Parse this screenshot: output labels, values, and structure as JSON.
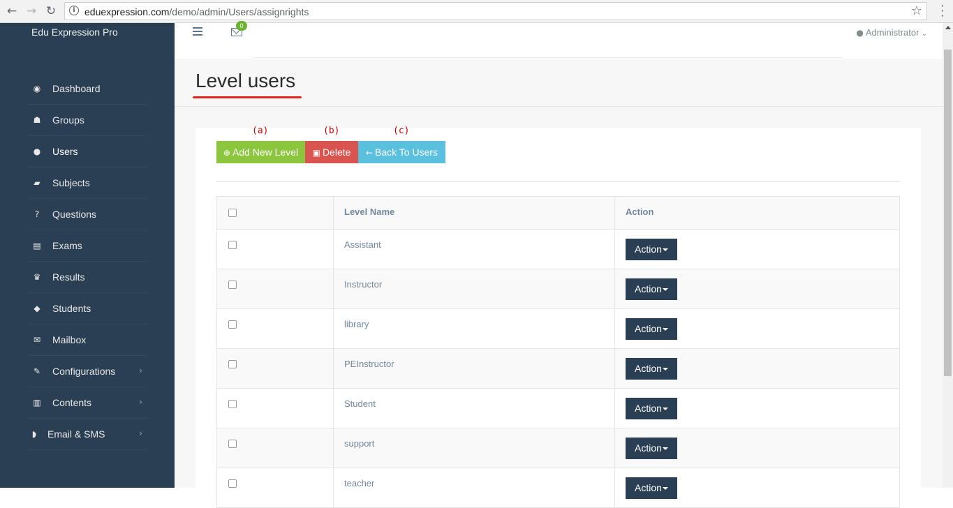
{
  "browser": {
    "back": "←",
    "forward": "→",
    "reload": "↻",
    "url_host": "eduexpression.com",
    "url_path": "/demo/admin/Users/assignrights"
  },
  "brand": "Edu Expression Pro",
  "sidebar": {
    "items": [
      {
        "label": "Dashboard",
        "icon": "dashboard-icon",
        "glyph": "◉"
      },
      {
        "label": "Groups",
        "icon": "users-group-icon",
        "glyph": "☗"
      },
      {
        "label": "Users",
        "icon": "user-icon",
        "glyph": "●"
      },
      {
        "label": "Subjects",
        "icon": "book-icon",
        "glyph": "▰"
      },
      {
        "label": "Questions",
        "icon": "question-icon",
        "glyph": "?"
      },
      {
        "label": "Exams",
        "icon": "list-icon",
        "glyph": "▤"
      },
      {
        "label": "Results",
        "icon": "trophy-icon",
        "glyph": "♛"
      },
      {
        "label": "Students",
        "icon": "graduation-cap-icon",
        "glyph": "◆"
      },
      {
        "label": "Mailbox",
        "icon": "envelope-icon",
        "glyph": "✉"
      },
      {
        "label": "Configurations",
        "icon": "wrench-icon",
        "glyph": "✎"
      },
      {
        "label": "Contents",
        "icon": "contents-icon",
        "glyph": "▥"
      },
      {
        "label": "Email & SMS",
        "icon": "shield-icon",
        "glyph": "◗"
      }
    ]
  },
  "topnav": {
    "mail_count": "0",
    "user": "Administrator"
  },
  "page": {
    "title": "Level users"
  },
  "annotations": {
    "a": "(a)",
    "b": "(b)",
    "c": "(c)"
  },
  "toolbar": {
    "add_label": "Add New Level",
    "delete_label": "Delete",
    "back_label": "Back To Users"
  },
  "table": {
    "headers": {
      "name": "Level Name",
      "action": "Action"
    },
    "action_label": "Action",
    "rows": [
      {
        "name": "Assistant"
      },
      {
        "name": "Instructor"
      },
      {
        "name": "library"
      },
      {
        "name": "PEInstructor"
      },
      {
        "name": "Student"
      },
      {
        "name": "support"
      },
      {
        "name": "teacher"
      }
    ]
  },
  "colors": {
    "sidebar": "#2a3f54",
    "add": "#8cc63f",
    "delete": "#d9534f",
    "back": "#5bc0de",
    "title_underline": "#e0261e",
    "annotation": "#cc0000"
  }
}
